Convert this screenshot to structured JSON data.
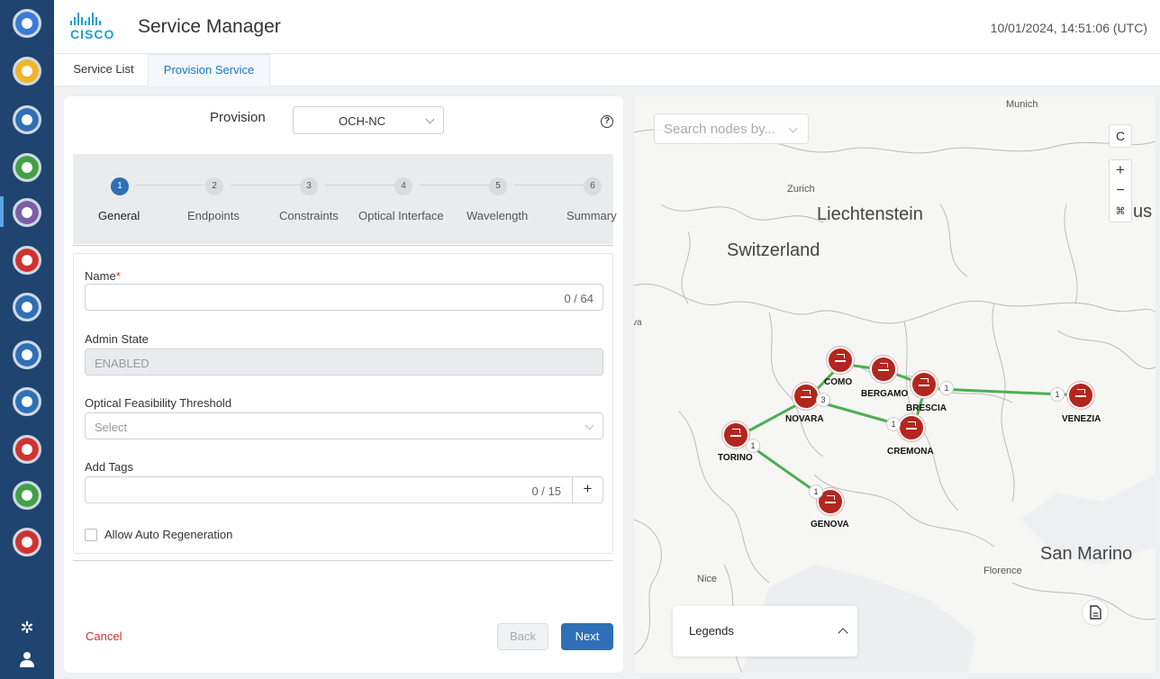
{
  "header": {
    "logo_text": "CISCO",
    "title": "Service Manager",
    "datetime": "10/01/2024, 14:51:06 (UTC)"
  },
  "tabs": [
    {
      "label": "Service List",
      "active": false
    },
    {
      "label": "Provision Service",
      "active": true
    }
  ],
  "form": {
    "provision_label": "Provision",
    "provision_value": "OCH-NC",
    "help_glyph": "?",
    "steps": [
      {
        "number": "1",
        "label": "General",
        "active": true
      },
      {
        "number": "2",
        "label": "Endpoints",
        "active": false
      },
      {
        "number": "3",
        "label": "Constraints",
        "active": false
      },
      {
        "number": "4",
        "label": "Optical Interface",
        "active": false
      },
      {
        "number": "5",
        "label": "Wavelength",
        "active": false
      },
      {
        "number": "6",
        "label": "Summary",
        "active": false
      }
    ],
    "name_label": "Name",
    "name_required": "*",
    "name_counter": "0 / 64",
    "admin_state_label": "Admin State",
    "admin_state_value": "ENABLED",
    "threshold_label": "Optical Feasibility Threshold",
    "threshold_placeholder": "Select",
    "tags_label": "Add Tags",
    "tags_counter": "0 / 15",
    "tags_add": "+",
    "auto_regen_label": "Allow Auto Regeneration",
    "cancel_label": "Cancel",
    "back_label": "Back",
    "next_label": "Next"
  },
  "map": {
    "search_placeholder": "Search nodes by...",
    "refresh_glyph": "C",
    "zoom_in": "+",
    "zoom_out": "−",
    "fit_glyph": "⌘",
    "places": {
      "munich": "Munich",
      "zurich": "Zurich",
      "liechtenstein": "Liechtenstein",
      "switzerland": "Switzerland",
      "san_marino": "San Marino",
      "florence": "Florence",
      "nice": "Nice",
      "edge_left": "va",
      "edge_right": "us"
    },
    "nodes": {
      "como": "COMO",
      "bergamo": "BERGAMO",
      "brescia": "BRESCIA",
      "venezia": "VENEZIA",
      "novara": "NOVARA",
      "cremona": "CREMONA",
      "torino": "TORINO",
      "genova": "GENOVA"
    },
    "badges": {
      "novara": "3",
      "brescia": "1",
      "venezia": "1",
      "cremona": "1",
      "torino": "1",
      "genova": "1",
      "torino_top": "1"
    },
    "legends_label": "Legends",
    "link_color": "#4caf50",
    "node_color": "#b3261e"
  },
  "colors": {
    "rail": "#1f4470",
    "primary": "#2f6fb6",
    "cancel": "#d0322f",
    "tab_active": "#1976c2"
  }
}
